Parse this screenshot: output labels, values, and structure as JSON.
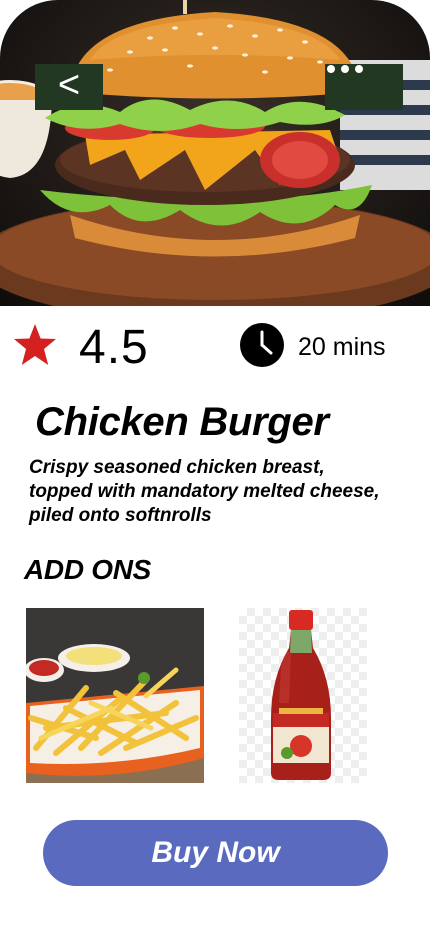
{
  "header": {
    "back_label": "<",
    "more_icon": "more-icon",
    "hero_image": "burger-photo"
  },
  "info": {
    "rating_icon": "star-icon",
    "rating": "4.5",
    "time_icon": "clock-icon",
    "prep_time": "20 mins"
  },
  "product": {
    "title": "Chicken Burger",
    "description": "Crispy seasoned chicken breast, topped with mandatory melted cheese, piled onto softnrolls"
  },
  "addons": {
    "heading": "ADD ONS",
    "items": [
      {
        "image": "fries-photo"
      },
      {
        "image": "ketchup-bottle-photo"
      }
    ]
  },
  "cta": {
    "label": "Buy Now"
  },
  "colors": {
    "nav_button_bg": "#233823",
    "star": "#d42020",
    "buy_button": "#5a6bbf",
    "text": "#000000"
  }
}
